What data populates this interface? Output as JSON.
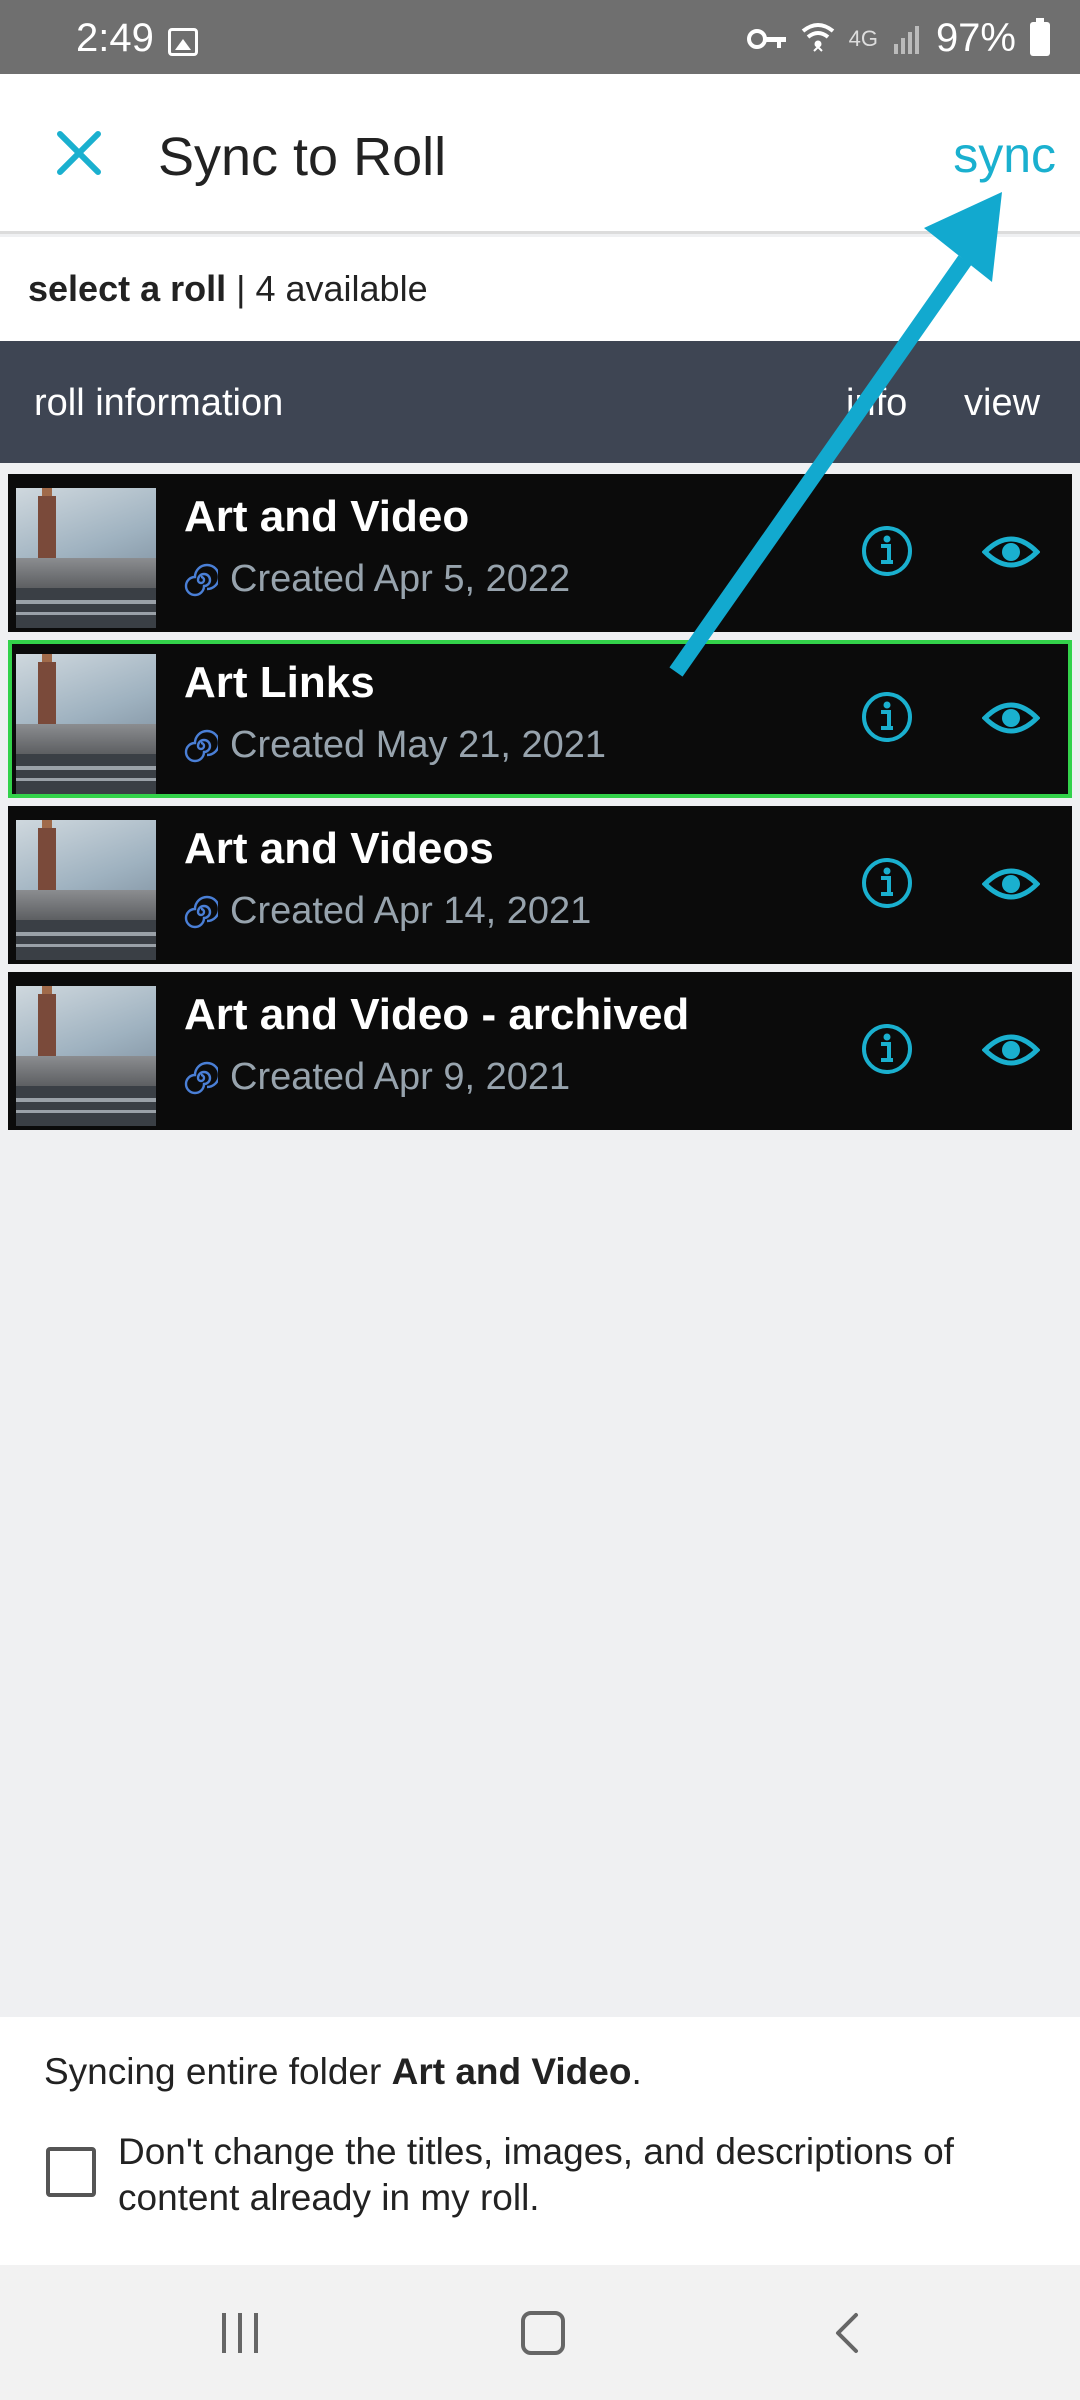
{
  "status_bar": {
    "time": "2:49",
    "network": "4G",
    "battery": "97%"
  },
  "header": {
    "title": "Sync to Roll",
    "sync_label": "sync"
  },
  "subheader": {
    "bold": "select a roll",
    "rest": " | 4 available"
  },
  "columns": {
    "roll_information": "roll information",
    "info": "info",
    "view": "view"
  },
  "rolls": [
    {
      "name": "Art and Video",
      "created": "Created Apr 5, 2022",
      "selected": false
    },
    {
      "name": "Art Links",
      "created": "Created May 21, 2021",
      "selected": true
    },
    {
      "name": "Art and Videos",
      "created": "Created Apr 14, 2021",
      "selected": false
    },
    {
      "name": "Art and Video - archived",
      "created": "Created Apr 9, 2021",
      "selected": false
    }
  ],
  "footer": {
    "sync_prefix": "Syncing entire folder ",
    "sync_folder": "Art and Video",
    "sync_suffix": ".",
    "checkbox_label": "Don't change the titles, images, and descriptions of content already in my roll.",
    "checkbox_checked": false
  },
  "colors": {
    "accent": "#1ab0cf",
    "header_bg": "#3e4553",
    "row_bg": "#0b0b0b",
    "selected_outline": "#33d24a"
  },
  "icons": [
    "close-icon",
    "info-icon",
    "eye-icon",
    "spiral-icon",
    "recent-apps-icon",
    "home-icon",
    "back-icon"
  ]
}
